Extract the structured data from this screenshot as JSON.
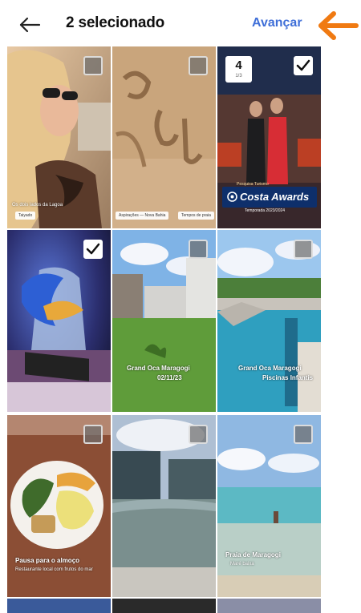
{
  "header": {
    "title": "2 selecionado",
    "next_label": "Avançar"
  },
  "icons": {
    "back": "arrow-left-icon",
    "annotation": "orange-arrow-left-icon",
    "checkbox": "checkbox-icon",
    "checkmark": "checkmark-icon"
  },
  "colors": {
    "accent": "#3f6fd8",
    "annotation": "#f07a12"
  },
  "grid": {
    "items": [
      {
        "selected": false,
        "captions": [
          "Os dois lados da Lagoa",
          "Taiyado"
        ]
      },
      {
        "selected": false,
        "captions": [
          "Aspirações — Nova Bahia",
          "Tempos de praia"
        ]
      },
      {
        "selected": true,
        "order": "4",
        "order_caption": "1/3",
        "award_top": "Pesquisa Turismo",
        "award_title": "Costa Awards",
        "award_sub": "Temporada 2023/2024"
      },
      {
        "selected": true,
        "captions": []
      },
      {
        "selected": false,
        "captions": [
          "Grand Oca Maragogi",
          "02/11/23"
        ]
      },
      {
        "selected": false,
        "captions": [
          "Grand Oca Maragogi",
          "Piscinas Infantis"
        ]
      },
      {
        "selected": false,
        "captions": [
          "Pausa para o almoço",
          "Restaurante local com frutos do mar"
        ]
      },
      {
        "selected": false,
        "captions": []
      },
      {
        "selected": false,
        "captions": [
          "Praia de Maragogi",
          "Maré baixa"
        ]
      }
    ]
  }
}
